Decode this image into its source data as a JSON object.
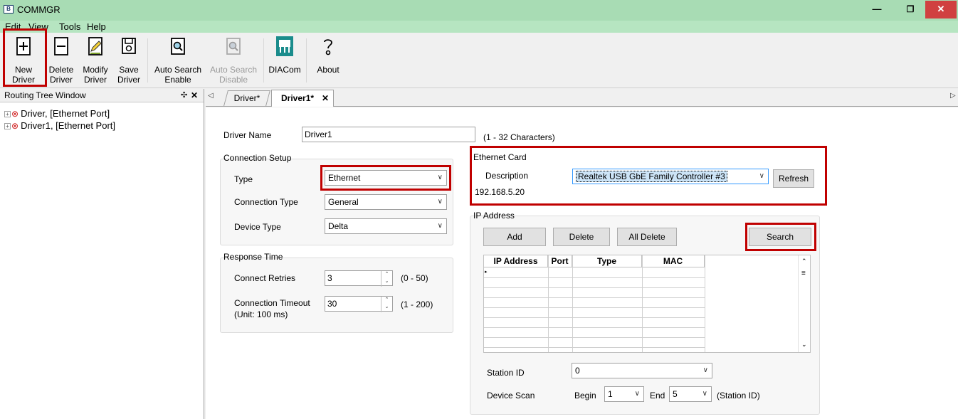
{
  "window": {
    "title": "COMMGR",
    "icon_text": "B"
  },
  "menu": [
    "Edit",
    "View",
    "Tools",
    "Help"
  ],
  "toolbar": {
    "new_driver": [
      "New",
      "Driver"
    ],
    "delete_driver": [
      "Delete",
      "Driver"
    ],
    "modify_driver": [
      "Modify",
      "Driver"
    ],
    "save_driver": [
      "Save",
      "Driver"
    ],
    "auto_search_enable": [
      "Auto Search",
      "Enable"
    ],
    "auto_search_disable": [
      "Auto Search",
      "Disable"
    ],
    "diacom": "DIACom",
    "about": "About"
  },
  "left_panel": {
    "title": "Routing Tree Window",
    "pin": "✣",
    "close": "✕",
    "items": [
      {
        "expander": "+",
        "status": "⊗",
        "label": "Driver,  [Ethernet Port]"
      },
      {
        "expander": "+",
        "status": "⊗",
        "label": "Driver1,  [Ethernet Port]"
      }
    ]
  },
  "tabs": {
    "left_arrow": "◁",
    "right_arrow": "▷",
    "items": [
      {
        "label": "Driver*",
        "active": false
      },
      {
        "label": "Driver1*",
        "active": true,
        "close": "✕"
      }
    ]
  },
  "form": {
    "driver_name_label": "Driver Name",
    "driver_name_value": "Driver1",
    "driver_name_hint": "(1 - 32 Characters)",
    "connection_setup": {
      "title": "Connection Setup",
      "type_label": "Type",
      "type_value": "Ethernet",
      "connection_type_label": "Connection Type",
      "connection_type_value": "General",
      "device_type_label": "Device Type",
      "device_type_value": "Delta"
    },
    "response_time": {
      "title": "Response Time",
      "retries_label": "Connect Retries",
      "retries_value": "3",
      "retries_range": "(0 - 50)",
      "timeout_label": "Connection Timeout",
      "timeout_unit": "(Unit: 100 ms)",
      "timeout_value": "30",
      "timeout_range": "(1 - 200)"
    },
    "ethernet_card": {
      "title": "Ethernet Card",
      "description_label": "Description",
      "description_value": "Realtek USB GbE Family Controller #3",
      "ip": "192.168.5.20",
      "refresh_label": "Refresh"
    },
    "ip_address": {
      "title": "IP Address",
      "add_label": "Add",
      "delete_label": "Delete",
      "all_delete_label": "All Delete",
      "search_label": "Search",
      "columns": [
        "IP Address",
        "Port",
        "Type",
        "MAC"
      ],
      "rows": []
    },
    "station_id_label": "Station ID",
    "station_id_value": "0",
    "device_scan_label": "Device Scan",
    "begin_label": "Begin",
    "begin_value": "1",
    "end_label": "End",
    "end_value": "5",
    "station_hint": "(Station ID)"
  },
  "colors": {
    "titlebar": "#a8dcb4",
    "highlight": "#c00000",
    "selection": "#3399ff"
  }
}
